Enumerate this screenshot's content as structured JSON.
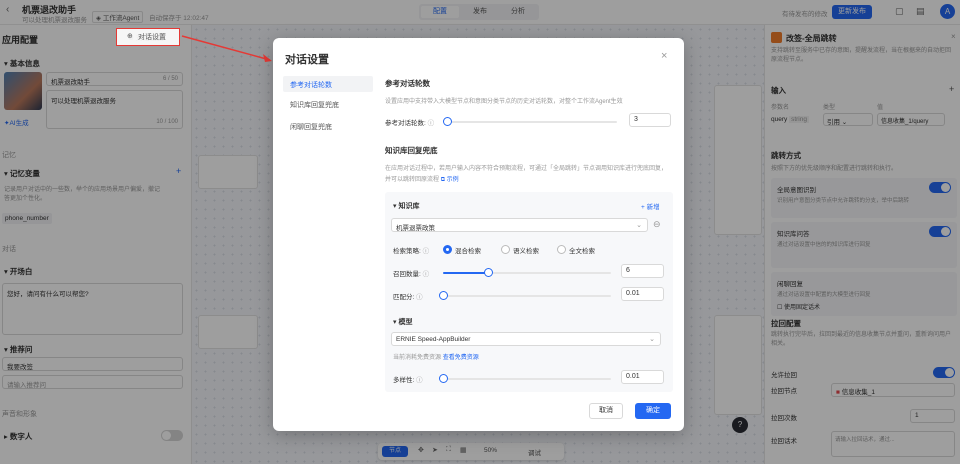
{
  "header": {
    "back_icon": "chevron-left-icon",
    "app_name": "机票退改助手",
    "app_desc": "可以处理机票退改服务",
    "mode_badge": "工作流Agent",
    "autosave": "自动保存于 12:02:47",
    "tabs": [
      {
        "label": "配置",
        "active": true
      },
      {
        "label": "发布"
      },
      {
        "label": "分析"
      }
    ],
    "unpublished": "有待发布的修改",
    "publish_button": "更新发布",
    "avatar": "A"
  },
  "left": {
    "title": "应用配置",
    "dialog_settings": "对话设置",
    "basic_info": "基本信息",
    "app_name": "机票退改助手",
    "name_count": "6 / 50",
    "app_desc": "可以处理机票退改服务",
    "desc_count": "10 / 100",
    "ai_generate": "AI生成",
    "memory": "记忆",
    "memory_var": "记忆变量",
    "memory_desc_1": "记录用户对话中的一些数，举个的应用场景用户偏爱，撤记",
    "memory_desc_2": "答更加个性化。",
    "var_name": "phone_number",
    "dialog": "对话",
    "opening": "开场白",
    "opening_text": "您好，请问有什么可以帮您?",
    "suggest": "推荐问",
    "suggest_1": "我要改签",
    "suggest_2_placeholder": "请输入推荐问",
    "voice": "声音和形象",
    "digital_human": "数字人"
  },
  "modal": {
    "title": "对话设置",
    "nav": [
      "参考对话轮数",
      "知识库回复兜底",
      "闲聊回复兜底"
    ],
    "rounds_title": "参考对话轮数",
    "rounds_desc": "设置应用中支持带入大模型节点和意图分类节点的历史对话轮数，对整个工作流Agent生效",
    "rounds_label": "参考对话轮数:",
    "rounds_value": "3",
    "rounds_fraction": 0.0,
    "kb_title": "知识库回复兜底",
    "kb_desc_1": "在应用对话过程中，若用户输入内容不符合预期流程，可通过「全局跳转」节点调用知识库进行兜底回复，",
    "kb_desc_2": "并可以跳转回原流程",
    "example": "示例",
    "kb_section": "知识库",
    "add": "+ 新增",
    "kb_selected": "机票退票政策",
    "strategy_label": "检索策略:",
    "strategies": [
      {
        "label": "混合检索",
        "on": true
      },
      {
        "label": "语义检索",
        "on": false
      },
      {
        "label": "全文检索",
        "on": false
      }
    ],
    "recall_label": "召回数量:",
    "recall_value": "6",
    "recall_fraction": 0.27,
    "match_label": "匹配分:",
    "match_value": "0.01",
    "match_fraction": 0.0,
    "model_section": "模型",
    "model_selected": "ERNIE Speed-AppBuilder",
    "model_note": "当前消耗免费资源",
    "model_link": "查看免费资源",
    "diversity_label": "多样性:",
    "diversity_value": "0.01",
    "diversity_fraction": 0.0,
    "cancel": "取消",
    "confirm": "确定"
  },
  "right": {
    "title": "改签-全局跳转",
    "desc": "支持跳转至服务中已存的意图，提醒发流程，当在根据来的自动拒回原流程节点。",
    "input": "输入",
    "col_param": "参数名",
    "col_type": "类型",
    "col_value": "值",
    "param": "query",
    "param_type": "string",
    "ref": "引用",
    "ref_value": "信息收集_1/query",
    "jump_mode": "跳转方式",
    "jump_desc": "按照下方的优先级顺序和配置进行跳转和执行。",
    "opt1": "全局意图识别",
    "opt1_desc": "识别用户意图分类节点中允许跳转的分支，举中后跳转",
    "opt2": "知识库问答",
    "opt2_desc": "通过对话设置中信的的知识库进行回复",
    "opt3": "闲聊回复",
    "opt3_desc": "通过对话设置中配置的大模型进行回复",
    "opt3_sub": "使用固定话术",
    "back_config": "拉回配置",
    "back_desc": "跳转执行完毕后，拉回到最近的信息收集节点并重问，重新询问用户相关。",
    "allow_back": "允许拉回",
    "back_node": "拉回节点",
    "back_node_value": "信息收集_1",
    "back_count": "拉回次数",
    "back_count_value": "1",
    "back_script": "拉回话术",
    "back_script_placeholder": "请输入拉回话术，通过..."
  },
  "canvas": {
    "toolbar_node": "节点",
    "zoom": "50%",
    "debug": "调试",
    "help": "?"
  }
}
